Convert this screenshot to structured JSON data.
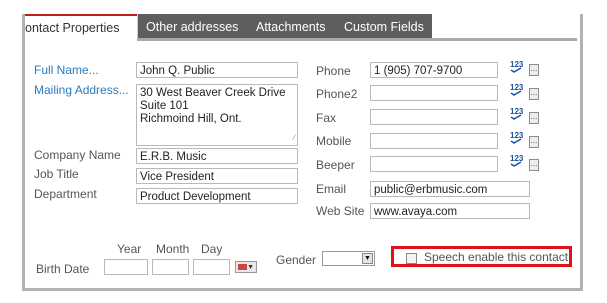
{
  "tabs": [
    "ontact Properties",
    "Other addresses",
    "Attachments",
    "Custom Fields"
  ],
  "left": {
    "full_name_link": "Full Name...",
    "full_name_value": "John Q. Public",
    "mailing_address_link": "Mailing Address...",
    "mailing_address_lines": [
      "30 West Beaver Creek Drive",
      "Suite 101",
      "Richmoind Hill, Ont."
    ],
    "company_label": "Company Name",
    "company_value": "E.R.B. Music",
    "job_title_label": "Job Title",
    "job_title_value": "Vice President",
    "department_label": "Department",
    "department_value": "Product Development"
  },
  "right": {
    "phone_label": "Phone",
    "phone_value": "1 (905) 707-9700",
    "phone2_label": "Phone2",
    "phone2_value": "",
    "fax_label": "Fax",
    "fax_value": "",
    "mobile_label": "Mobile",
    "mobile_value": "",
    "beeper_label": "Beeper",
    "beeper_value": "",
    "email_label": "Email",
    "email_value": "public@erbmusic.com",
    "website_label": "Web Site",
    "website_value": "www.avaya.com",
    "number_glyph": "123",
    "dots_glyph": "..."
  },
  "birth": {
    "label": "Birth Date",
    "year_label": "Year",
    "month_label": "Month",
    "day_label": "Day"
  },
  "gender_label": "Gender",
  "speech_label": "Speech enable this contact",
  "colors": {
    "tab_bg": "#5e5e5e",
    "link": "#2a7bbd",
    "highlight": "#e0101b",
    "accent": "#c21d1d"
  }
}
